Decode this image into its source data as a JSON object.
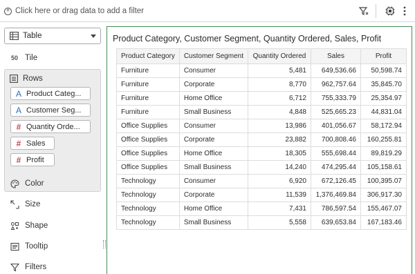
{
  "filter_bar": {
    "hint": "Click here or drag data to add a filter",
    "icons": [
      "add-filter-icon",
      "filter-settings-icon",
      "visualization-settings-icon",
      "more-options-icon"
    ]
  },
  "left_panel": {
    "viz_type": {
      "label": "Table",
      "icon": "table-icon"
    },
    "tile_label": "Tile",
    "rows": {
      "label": "Rows",
      "pills": [
        {
          "label": "Product Categ...",
          "type": "attribute"
        },
        {
          "label": "Customer Seg...",
          "type": "attribute"
        },
        {
          "label": "Quantity Orde...",
          "type": "measure"
        },
        {
          "label": "Sales",
          "type": "measure"
        },
        {
          "label": "Profit",
          "type": "measure"
        }
      ]
    },
    "grammar": [
      {
        "label": "Color",
        "icon": "palette-icon"
      },
      {
        "label": "Size",
        "icon": "resize-icon"
      },
      {
        "label": "Shape",
        "icon": "shapes-icon"
      },
      {
        "label": "Tooltip",
        "icon": "tooltip-icon"
      },
      {
        "label": "Filters",
        "icon": "filter-icon"
      }
    ]
  },
  "canvas": {
    "title": "Product Category, Customer Segment, Quantity Ordered, Sales, Profit",
    "table": {
      "columns": [
        "Product Category",
        "Customer Segment",
        "Quantity Ordered",
        "Sales",
        "Profit"
      ],
      "rows": [
        [
          "Furniture",
          "Consumer",
          "5,481",
          "649,536.66",
          "50,598.74"
        ],
        [
          "Furniture",
          "Corporate",
          "8,770",
          "962,757.64",
          "35,845.70"
        ],
        [
          "Furniture",
          "Home Office",
          "6,712",
          "755,333.79",
          "25,354.97"
        ],
        [
          "Furniture",
          "Small Business",
          "4,848",
          "525,665.23",
          "44,831.04"
        ],
        [
          "Office Supplies",
          "Consumer",
          "13,986",
          "401,056.67",
          "58,172.94"
        ],
        [
          "Office Supplies",
          "Corporate",
          "23,882",
          "700,808.46",
          "160,255.81"
        ],
        [
          "Office Supplies",
          "Home Office",
          "18,305",
          "555,698.44",
          "89,819.29"
        ],
        [
          "Office Supplies",
          "Small Business",
          "14,240",
          "474,295.44",
          "105,158.61"
        ],
        [
          "Technology",
          "Consumer",
          "6,920",
          "672,126.45",
          "100,395.07"
        ],
        [
          "Technology",
          "Corporate",
          "11,539",
          "1,376,469.84",
          "306,917.30"
        ],
        [
          "Technology",
          "Home Office",
          "7,431",
          "786,597.54",
          "155,467.07"
        ],
        [
          "Technology",
          "Small Business",
          "5,558",
          "639,653.84",
          "167,183.46"
        ]
      ]
    }
  },
  "colors": {
    "canvas_border": "#3f8a52",
    "attribute_icon": "#2b6fb8",
    "measure_icon": "#c24a4a",
    "rows_box_bg": "#ececec"
  }
}
